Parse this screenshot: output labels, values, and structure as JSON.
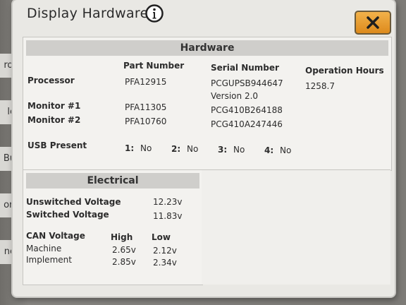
{
  "window": {
    "title": "Display Hardware",
    "info_icon": "info-icon",
    "close_icon": "close-x-icon"
  },
  "background_tabs": [
    "rol",
    "le",
    "Bu",
    "ori",
    "ne"
  ],
  "hardware": {
    "section_title": "Hardware",
    "columns": {
      "part_number": "Part Number",
      "serial_number": "Serial Number",
      "operation_hours": "Operation Hours"
    },
    "processor": {
      "label": "Processor",
      "part_number": "PFA12915",
      "serial_number": "PCGUPSB944647",
      "version": "Version 2.0",
      "operation_hours": "1258.7"
    },
    "monitor1": {
      "label": "Monitor #1",
      "part_number": "PFA11305",
      "serial_number": "PCG410B264188"
    },
    "monitor2": {
      "label": "Monitor #2",
      "part_number": "PFA10760",
      "serial_number": "PCG410A247446"
    },
    "usb": {
      "label": "USB Present",
      "ports": [
        {
          "num": "1:",
          "value": "No"
        },
        {
          "num": "2:",
          "value": "No"
        },
        {
          "num": "3:",
          "value": "No"
        },
        {
          "num": "4:",
          "value": "No"
        }
      ]
    }
  },
  "electrical": {
    "section_title": "Electrical",
    "unswitched_label": "Unswitched Voltage",
    "unswitched_value": "12.23v",
    "switched_label": "Switched Voltage",
    "switched_value": "11.83v",
    "can_label": "CAN Voltage",
    "high_label": "High",
    "low_label": "Low",
    "machine_label": "Machine",
    "machine_high": "2.65v",
    "machine_low": "2.12v",
    "implement_label": "Implement",
    "implement_high": "2.85v",
    "implement_low": "2.34v"
  }
}
